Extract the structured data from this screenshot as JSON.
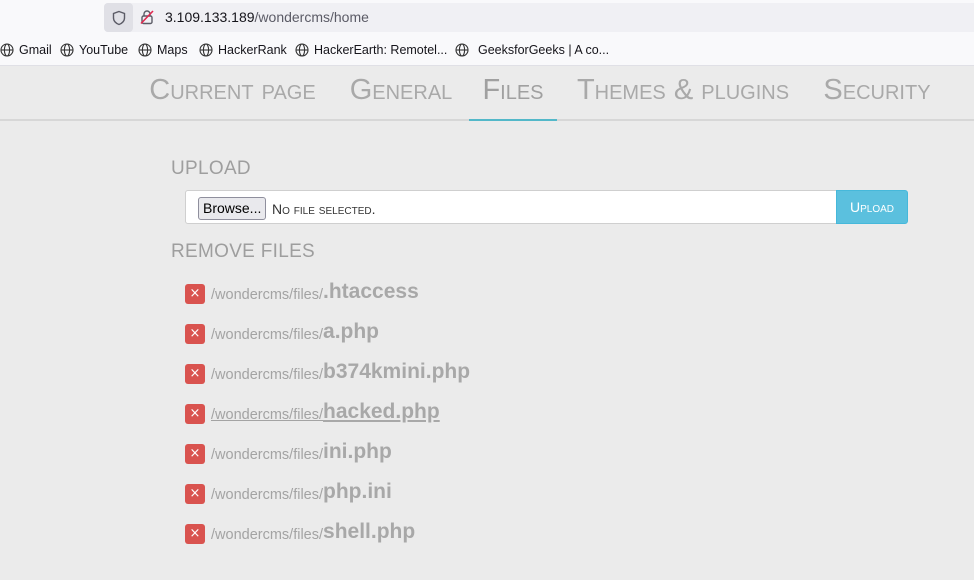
{
  "browser": {
    "url_host": "3.109.133.189",
    "url_path": "/wondercms/home"
  },
  "bookmarks": [
    {
      "label": "Gmail"
    },
    {
      "label": "YouTube"
    },
    {
      "label": "Maps"
    },
    {
      "label": "HackerRank"
    },
    {
      "label": "HackerEarth: Remotel..."
    },
    {
      "label": "GeeksforGeeks | A co..."
    }
  ],
  "tabs": [
    {
      "label": "Current page"
    },
    {
      "label": "General"
    },
    {
      "label": "Files",
      "active": true
    },
    {
      "label": "Themes & plugins"
    },
    {
      "label": "Security"
    }
  ],
  "upload": {
    "title": "Upload",
    "browse_label": "Browse...",
    "no_file_text": "No file selected.",
    "upload_button": "Upload"
  },
  "remove": {
    "title": "Remove files",
    "base_path": "/wondercms/files/",
    "files": [
      ".htaccess",
      "a.php",
      "b374kmini.php",
      "hacked.php",
      "ini.php",
      "php.ini",
      "shell.php"
    ],
    "delete_symbol": "×"
  },
  "colors": {
    "accent": "#53b8c9",
    "danger": "#d9534f",
    "info": "#5bc0de"
  }
}
